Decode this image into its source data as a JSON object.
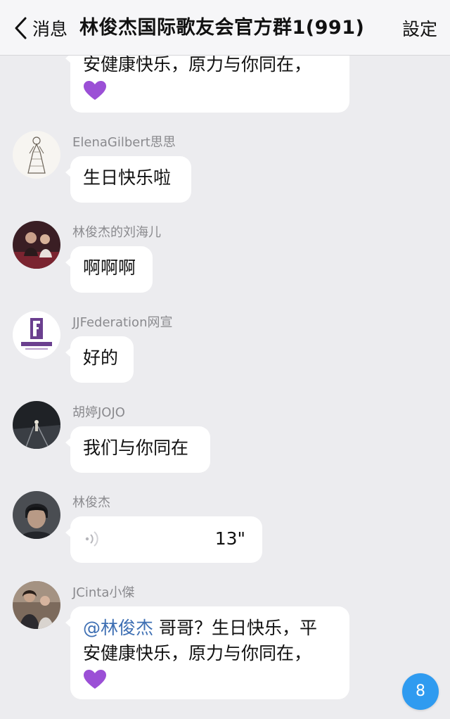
{
  "header": {
    "back_label": "消息",
    "title": "林俊杰国际歌友会官方群1(991)",
    "settings_label": "設定"
  },
  "messages": [
    {
      "sender": "",
      "text_lines": [
        "安健康快乐，原力与你同在，"
      ],
      "emoji": "purple-heart"
    },
    {
      "sender": "ElenaGilbert思思",
      "text": "生日快乐啦",
      "avatar_icon": "sketch-dress-avatar"
    },
    {
      "sender": "林俊杰的刘海儿",
      "text": "啊啊啊",
      "avatar_icon": "concert-photo-avatar"
    },
    {
      "sender": "JJFederation网宣",
      "text": "好的",
      "avatar_icon": "jj-federation-logo-avatar"
    },
    {
      "sender": "胡婷JOJO",
      "text": "我们与你同在",
      "avatar_icon": "night-road-avatar"
    },
    {
      "sender": "林俊杰",
      "voice_duration": "13\"",
      "avatar_icon": "portrait-avatar"
    },
    {
      "sender": "JCinta小傑",
      "mention": "@林俊杰",
      "text_lines": [
        " 哥哥？生日快乐，平",
        "安健康快乐，原力与你同在，"
      ],
      "emoji": "purple-heart",
      "avatar_icon": "couple-photo-avatar"
    }
  ],
  "unread_badge": "8",
  "colors": {
    "background": "#ececef",
    "bubble": "#ffffff",
    "mention": "#3e6fb3",
    "badge": "#2f9bf0",
    "heart": "#9b4fd6"
  }
}
